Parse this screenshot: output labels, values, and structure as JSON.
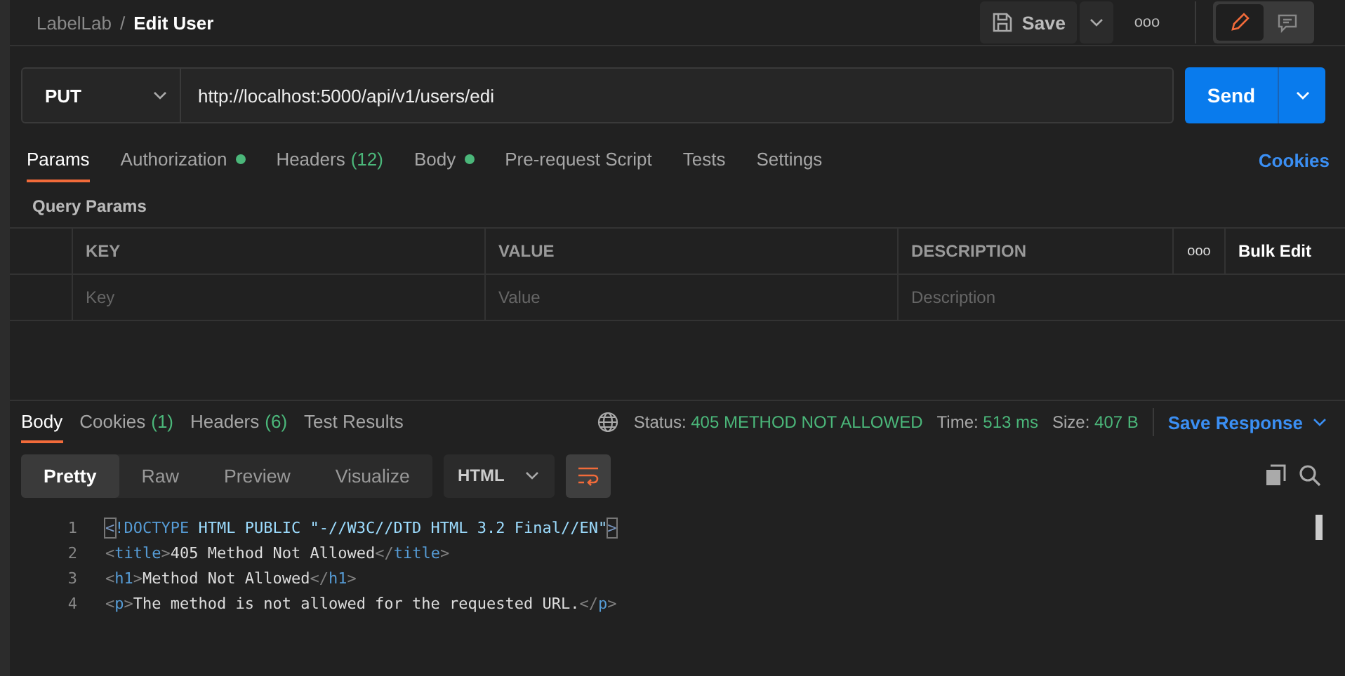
{
  "breadcrumb": {
    "workspace": "LabelLab",
    "separator": "/",
    "title": "Edit User"
  },
  "toolbar": {
    "save": "Save",
    "more": "ooo"
  },
  "view_toggle": [
    {
      "kind": "edit",
      "selected": true
    },
    {
      "kind": "comment",
      "selected": false
    }
  ],
  "request": {
    "method": "PUT",
    "url": "http://localhost:5000/api/v1/users/edi",
    "send": "Send"
  },
  "request_tabs": [
    {
      "label": "Params",
      "selected": true,
      "dot": false
    },
    {
      "label": "Authorization",
      "selected": false,
      "dot": true
    },
    {
      "label": "Headers",
      "count": "(12)",
      "selected": false,
      "dot": false
    },
    {
      "label": "Body",
      "selected": false,
      "dot": true
    },
    {
      "label": "Pre-request Script",
      "selected": false,
      "dot": false
    },
    {
      "label": "Tests",
      "selected": false,
      "dot": false
    },
    {
      "label": "Settings",
      "selected": false,
      "dot": false
    }
  ],
  "cookies_link": "Cookies",
  "query_params": {
    "title": "Query Params",
    "columns": [
      "KEY",
      "VALUE",
      "DESCRIPTION"
    ],
    "more": "ooo",
    "bulk_edit": "Bulk Edit",
    "placeholders": [
      "Key",
      "Value",
      "Description"
    ]
  },
  "response_tabs": [
    {
      "label": "Body",
      "selected": true
    },
    {
      "label": "Cookies",
      "count": "(1)",
      "selected": false
    },
    {
      "label": "Headers",
      "count": "(6)",
      "selected": false
    },
    {
      "label": "Test Results",
      "selected": false
    }
  ],
  "status": [
    {
      "label": "Status:",
      "value": "405 METHOD NOT ALLOWED"
    },
    {
      "label": "Time:",
      "value": "513 ms"
    },
    {
      "label": "Size:",
      "value": "407 B"
    }
  ],
  "save_response": "Save Response",
  "view_modes": [
    {
      "label": "Pretty",
      "selected": true
    },
    {
      "label": "Raw",
      "selected": false
    },
    {
      "label": "Preview",
      "selected": false
    },
    {
      "label": "Visualize",
      "selected": false
    }
  ],
  "format": "HTML",
  "wrap": {
    "on": true
  },
  "code": [
    {
      "number": "1",
      "parts": [
        {
          "kind": "bracket",
          "text": "<"
        },
        {
          "kind": "tag",
          "text": "!DOCTYPE"
        },
        {
          "kind": "attr",
          "text": " HTML PUBLIC \"-//W3C//DTD HTML 3.2 Final//EN\""
        },
        {
          "kind": "bracket",
          "text": ">"
        }
      ]
    },
    {
      "number": "2",
      "parts": [
        {
          "kind": "punct",
          "text": "<"
        },
        {
          "kind": "tag",
          "text": "title"
        },
        {
          "kind": "punct",
          "text": ">"
        },
        {
          "kind": "text",
          "text": "405 Method Not Allowed"
        },
        {
          "kind": "punct",
          "text": "</"
        },
        {
          "kind": "tag",
          "text": "title"
        },
        {
          "kind": "punct",
          "text": ">"
        }
      ]
    },
    {
      "number": "3",
      "parts": [
        {
          "kind": "punct",
          "text": "<"
        },
        {
          "kind": "tag",
          "text": "h1"
        },
        {
          "kind": "punct",
          "text": ">"
        },
        {
          "kind": "text",
          "text": "Method Not Allowed"
        },
        {
          "kind": "punct",
          "text": "</"
        },
        {
          "kind": "tag",
          "text": "h1"
        },
        {
          "kind": "punct",
          "text": ">"
        }
      ]
    },
    {
      "number": "4",
      "parts": [
        {
          "kind": "punct",
          "text": "<"
        },
        {
          "kind": "tag",
          "text": "p"
        },
        {
          "kind": "punct",
          "text": ">"
        },
        {
          "kind": "text",
          "text": "The method is not allowed for the requested URL."
        },
        {
          "kind": "punct",
          "text": "</"
        },
        {
          "kind": "tag",
          "text": "p"
        },
        {
          "kind": "punct",
          "text": ">"
        }
      ]
    }
  ]
}
